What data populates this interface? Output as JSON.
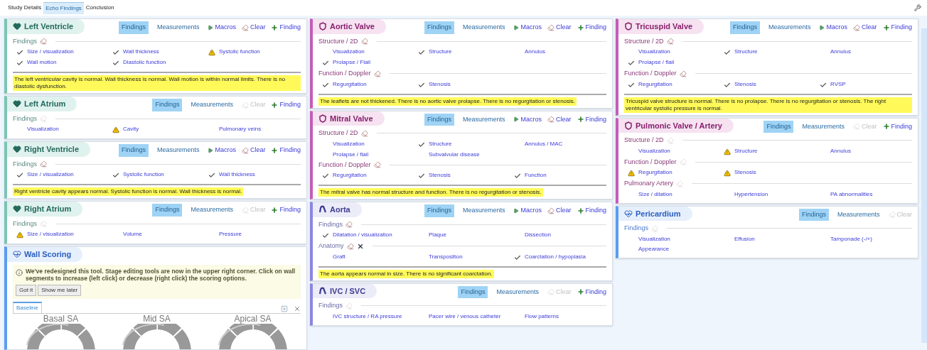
{
  "tabs": [
    {
      "label": "Study Details",
      "selected": false
    },
    {
      "label": "Echo Findings",
      "selected": true
    },
    {
      "label": "Conclusion",
      "selected": false
    }
  ],
  "columns": [
    {
      "panels": [
        {
          "kind": "chamber",
          "title": "Left Ventricle",
          "toolbar": [
            {
              "kind": "tab",
              "label": "Findings",
              "selected": true
            },
            {
              "kind": "tab",
              "label": "Measurements",
              "selected": false
            },
            {
              "kind": "macros",
              "label": "Macros"
            },
            {
              "kind": "clear",
              "label": "Clear",
              "disabled": false
            },
            {
              "kind": "add",
              "label": "Finding"
            }
          ],
          "sections": [
            {
              "label": "Findings",
              "clear_enabled": true,
              "items": [
                {
                  "label": "Size / visualization",
                  "kind": "check"
                },
                {
                  "label": "Wall thickness",
                  "kind": "check"
                },
                {
                  "label": "Systolic function",
                  "kind": "warning"
                },
                {
                  "label": "Wall motion",
                  "kind": "check"
                },
                {
                  "label": "Diastolic function",
                  "kind": "check"
                }
              ]
            }
          ],
          "summary": "The left ventricular cavity is normal. Wall thickness is normal. Wall motion is within normal limits. There is no diastolic dysfunction."
        },
        {
          "kind": "chamber",
          "title": "Left Atrium",
          "toolbar": [
            {
              "kind": "tab",
              "label": "Findings",
              "selected": true
            },
            {
              "kind": "tab",
              "label": "Measurements",
              "selected": false
            },
            {
              "kind": "clear",
              "label": "Clear",
              "disabled": true
            },
            {
              "kind": "add",
              "label": "Finding"
            }
          ],
          "sections": [
            {
              "label": "Findings",
              "clear_enabled": false,
              "items": [
                {
                  "label": "Visualization",
                  "kind": "plain"
                },
                {
                  "label": "Cavity",
                  "kind": "warning"
                },
                {
                  "label": "Pulmonary veins",
                  "kind": "plain"
                }
              ]
            }
          ]
        },
        {
          "kind": "chamber",
          "title": "Right Ventricle",
          "toolbar": [
            {
              "kind": "tab",
              "label": "Findings",
              "selected": true
            },
            {
              "kind": "tab",
              "label": "Measurements",
              "selected": false
            },
            {
              "kind": "macros",
              "label": "Macros"
            },
            {
              "kind": "clear",
              "label": "Clear",
              "disabled": false
            },
            {
              "kind": "add",
              "label": "Finding"
            }
          ],
          "sections": [
            {
              "label": "Findings",
              "clear_enabled": true,
              "items": [
                {
                  "label": "Size / visualization",
                  "kind": "check"
                },
                {
                  "label": "Systolic function",
                  "kind": "check"
                },
                {
                  "label": "Wall thickness",
                  "kind": "check"
                }
              ]
            }
          ],
          "summary": "Right ventricle cavity appears normal. Systolic function is normal. Wall thickness is normal."
        },
        {
          "kind": "chamber",
          "title": "Right Atrium",
          "toolbar": [
            {
              "kind": "tab",
              "label": "Findings",
              "selected": true
            },
            {
              "kind": "tab",
              "label": "Measurements",
              "selected": false
            },
            {
              "kind": "clear",
              "label": "Clear",
              "disabled": true
            },
            {
              "kind": "add",
              "label": "Finding"
            }
          ],
          "sections": [
            {
              "label": "Findings",
              "clear_enabled": false,
              "items": [
                {
                  "label": "Size / visualization",
                  "kind": "warning"
                },
                {
                  "label": "Volume",
                  "kind": "plain"
                },
                {
                  "label": "Pressure",
                  "kind": "plain"
                }
              ]
            }
          ]
        },
        {
          "kind": "scoring",
          "title": "Wall Scoring",
          "notice": "We've redesigned this tool. Stage editing tools are now in the upper right corner. Click on wall segments to increase (left click) or decrease (right click) the scoring options.",
          "notice_buttons": [
            "Got it",
            "Show me later"
          ],
          "stage_tabs": [
            {
              "label": "Baseline",
              "selected": true
            }
          ],
          "views": [
            "Basal SA",
            "Mid SA",
            "Apical SA"
          ]
        }
      ]
    },
    {
      "panels": [
        {
          "kind": "valve",
          "title": "Aortic Valve",
          "toolbar": [
            {
              "kind": "tab",
              "label": "Findings",
              "selected": true
            },
            {
              "kind": "tab",
              "label": "Measurements",
              "selected": false
            },
            {
              "kind": "macros",
              "label": "Macros"
            },
            {
              "kind": "clear",
              "label": "Clear",
              "disabled": false
            },
            {
              "kind": "add",
              "label": "Finding"
            }
          ],
          "sections": [
            {
              "label": "Structure / 2D",
              "clear_enabled": true,
              "items": [
                {
                  "label": "Visualization",
                  "kind": "plain"
                },
                {
                  "label": "Structure",
                  "kind": "check"
                },
                {
                  "label": "Annulus",
                  "kind": "plain"
                },
                {
                  "label": "Prolapse / Flail",
                  "kind": "check"
                }
              ]
            },
            {
              "label": "Function / Doppler",
              "clear_enabled": true,
              "items": [
                {
                  "label": "Regurgitation",
                  "kind": "check"
                },
                {
                  "label": "Stenosis",
                  "kind": "check"
                }
              ]
            }
          ],
          "summary": "The leaflets are not thickened. There is no aortic valve prolapse. There is no regurgitation or stenosis."
        },
        {
          "kind": "valve",
          "title": "Mitral Valve",
          "toolbar": [
            {
              "kind": "tab",
              "label": "Findings",
              "selected": true
            },
            {
              "kind": "tab",
              "label": "Measurements",
              "selected": false
            },
            {
              "kind": "macros",
              "label": "Macros"
            },
            {
              "kind": "clear",
              "label": "Clear",
              "disabled": false
            },
            {
              "kind": "add",
              "label": "Finding"
            }
          ],
          "sections": [
            {
              "label": "Structure / 2D",
              "clear_enabled": true,
              "items": [
                {
                  "label": "Visualization",
                  "kind": "plain"
                },
                {
                  "label": "Structure",
                  "kind": "check"
                },
                {
                  "label": "Annulus / MAC",
                  "kind": "plain"
                },
                {
                  "label": "Prolapse / flail",
                  "kind": "plain"
                },
                {
                  "label": "Subvalvular disease",
                  "kind": "plain"
                }
              ]
            },
            {
              "label": "Function / Doppler",
              "clear_enabled": true,
              "items": [
                {
                  "label": "Regurgitation",
                  "kind": "check"
                },
                {
                  "label": "Stenosis",
                  "kind": "check"
                },
                {
                  "label": "Function",
                  "kind": "check"
                }
              ]
            }
          ],
          "summary": "The mitral valve has normal structure and function. There is no regurgitation or stenosis."
        },
        {
          "kind": "vessel",
          "title": "Aorta",
          "toolbar": [
            {
              "kind": "tab",
              "label": "Findings",
              "selected": true
            },
            {
              "kind": "tab",
              "label": "Measurements",
              "selected": false
            },
            {
              "kind": "macros",
              "label": "Macros"
            },
            {
              "kind": "clear",
              "label": "Clear",
              "disabled": false
            },
            {
              "kind": "add",
              "label": "Finding"
            }
          ],
          "sections": [
            {
              "label": "Findings",
              "clear_enabled": true,
              "items": [
                {
                  "label": "Dilatation / visualization",
                  "kind": "check"
                },
                {
                  "label": "Plaque",
                  "kind": "plain"
                },
                {
                  "label": "Dissection",
                  "kind": "plain"
                }
              ]
            },
            {
              "label": "Anatomy",
              "clear_enabled": true,
              "removable": true,
              "items": [
                {
                  "label": "Graft",
                  "kind": "plain"
                },
                {
                  "label": "Transposition",
                  "kind": "plain"
                },
                {
                  "label": "Coarctation / hypoplasia",
                  "kind": "check"
                }
              ]
            }
          ],
          "summary": "The aorta appears normal in size. There is no significant coarctation."
        },
        {
          "kind": "vessel",
          "title": "IVC / SVC",
          "toolbar": [
            {
              "kind": "tab",
              "label": "Findings",
              "selected": true
            },
            {
              "kind": "tab",
              "label": "Measurements",
              "selected": false
            },
            {
              "kind": "clear",
              "label": "Clear",
              "disabled": true
            },
            {
              "kind": "add",
              "label": "Finding"
            }
          ],
          "sections": [
            {
              "label": "Findings",
              "clear_enabled": false,
              "items": [
                {
                  "label": "IVC structure / RA pressure",
                  "kind": "plain"
                },
                {
                  "label": "Pacer wire / venous catheter",
                  "kind": "plain"
                },
                {
                  "label": "Flow patterns",
                  "kind": "plain"
                }
              ]
            }
          ]
        }
      ]
    },
    {
      "panels": [
        {
          "kind": "valve",
          "title": "Tricuspid Valve",
          "toolbar": [
            {
              "kind": "tab",
              "label": "Findings",
              "selected": true
            },
            {
              "kind": "tab",
              "label": "Measurements",
              "selected": false
            },
            {
              "kind": "macros",
              "label": "Macros"
            },
            {
              "kind": "clear",
              "label": "Clear",
              "disabled": false
            },
            {
              "kind": "add",
              "label": "Finding"
            }
          ],
          "sections": [
            {
              "label": "Structure / 2D",
              "clear_enabled": true,
              "items": [
                {
                  "label": "Visualization",
                  "kind": "plain"
                },
                {
                  "label": "Structure",
                  "kind": "check"
                },
                {
                  "label": "Annulus",
                  "kind": "plain"
                },
                {
                  "label": "Prolapse / flail",
                  "kind": "check"
                }
              ]
            },
            {
              "label": "Function / Doppler",
              "clear_enabled": true,
              "items": [
                {
                  "label": "Regurgitation",
                  "kind": "check"
                },
                {
                  "label": "Stenosis",
                  "kind": "check"
                },
                {
                  "label": "RVSP",
                  "kind": "check"
                }
              ]
            }
          ],
          "summary": "Tricuspid valve structure is normal. There is no prolapse. There is no regurgitation or stenosis. The right ventricular systolic pressure is normal."
        },
        {
          "kind": "valve",
          "title": "Pulmonic Valve / Artery",
          "toolbar": [
            {
              "kind": "tab",
              "label": "Findings",
              "selected": true
            },
            {
              "kind": "tab",
              "label": "Measurements",
              "selected": false
            },
            {
              "kind": "clear",
              "label": "Clear",
              "disabled": true
            },
            {
              "kind": "add",
              "label": "Finding"
            }
          ],
          "sections": [
            {
              "label": "Structure / 2D",
              "clear_enabled": false,
              "items": [
                {
                  "label": "Visualization",
                  "kind": "plain"
                },
                {
                  "label": "Structure",
                  "kind": "warning"
                },
                {
                  "label": "Annulus",
                  "kind": "plain"
                }
              ]
            },
            {
              "label": "Function / Doppler",
              "clear_enabled": false,
              "items": [
                {
                  "label": "Regurgitation",
                  "kind": "warning"
                },
                {
                  "label": "Stenosis",
                  "kind": "warning"
                }
              ]
            },
            {
              "label": "Pulmonary Artery",
              "clear_enabled": false,
              "items": [
                {
                  "label": "Size / dilation",
                  "kind": "plain"
                },
                {
                  "label": "Hypertension",
                  "kind": "plain"
                },
                {
                  "label": "PA abnormalities",
                  "kind": "plain"
                }
              ]
            }
          ]
        },
        {
          "kind": "other",
          "title": "Pericardium",
          "toolbar": [
            {
              "kind": "tab",
              "label": "Findings",
              "selected": true
            },
            {
              "kind": "tab",
              "label": "Measurements",
              "selected": false
            },
            {
              "kind": "clear",
              "label": "Clear",
              "disabled": true
            }
          ],
          "sections": [
            {
              "label": "Findings",
              "clear_enabled": false,
              "items": [
                {
                  "label": "Visualization",
                  "kind": "plain"
                },
                {
                  "label": "Effusion",
                  "kind": "plain"
                },
                {
                  "label": "Tamponade (-/+)",
                  "kind": "plain"
                },
                {
                  "label": "Appearance",
                  "kind": "plain"
                }
              ]
            }
          ]
        }
      ]
    }
  ]
}
